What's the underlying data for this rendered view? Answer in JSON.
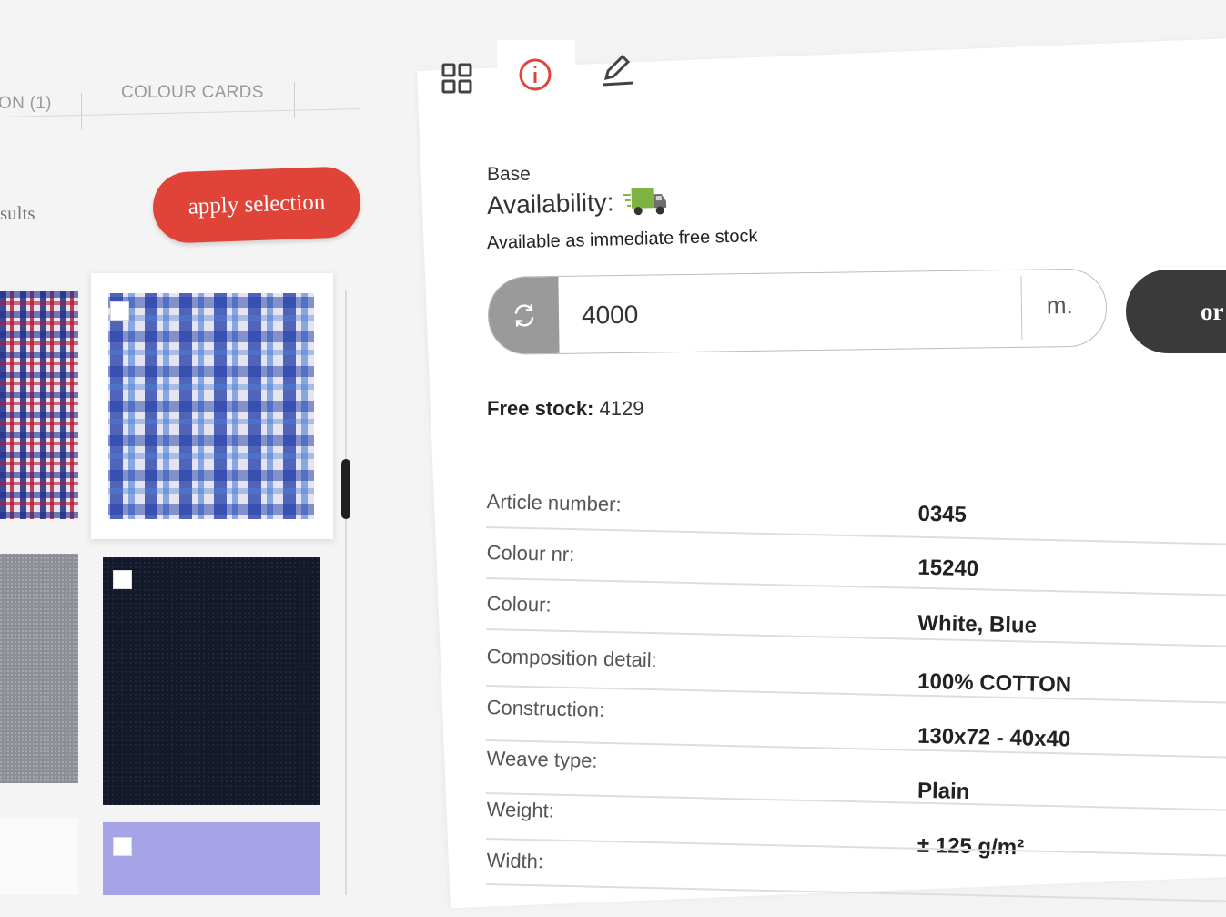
{
  "tabs": [
    {
      "label": "ON (1)"
    },
    {
      "label": "COLOUR CARDS"
    }
  ],
  "results_text": "sults",
  "apply_button": "apply selection",
  "detail_tabs": [
    "grid-icon",
    "info-icon",
    "pencil-icon"
  ],
  "base_label": "Base",
  "availability_label": "Availability:",
  "availability_note": "Available as immediate free stock",
  "quantity": {
    "value": "4000",
    "unit": "m."
  },
  "order_button": "or",
  "free_stock": {
    "label": "Free stock:",
    "value": "4129"
  },
  "specs": [
    {
      "label": "Article number:",
      "value": "0345"
    },
    {
      "label": "Colour nr:",
      "value": "15240"
    },
    {
      "label": "Colour:",
      "value": "White, Blue"
    },
    {
      "label": "Composition detail:",
      "value": "100% COTTON"
    },
    {
      "label": "Construction:",
      "value": "130x72 - 40x40"
    },
    {
      "label": "Weave type:",
      "value": "Plain"
    },
    {
      "label": "Weight:",
      "value": "± 125 g/m²"
    },
    {
      "label": "Width:",
      "value": ""
    }
  ],
  "colors": {
    "accent": "#e04438",
    "dark_button": "#3a3a3a",
    "reset_button": "#9a9a9a",
    "truck": "#7cb342"
  }
}
